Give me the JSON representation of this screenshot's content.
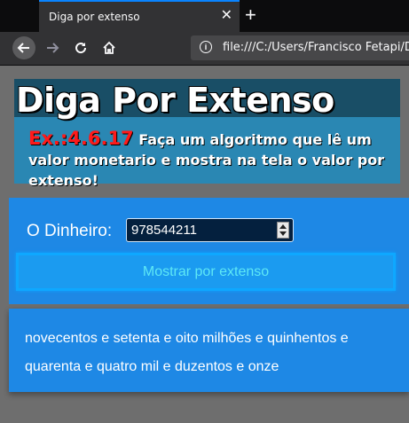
{
  "browser": {
    "tab_title": "Diga por extenso",
    "close_glyph": "✕",
    "new_tab_glyph": "+",
    "url": "file:///C:/Users/Francisco Fetapi/De"
  },
  "header": {
    "title": "Diga Por Extenso",
    "exercise_id": "Ex.:4.6.17",
    "description": " Faça um algoritmo que lê um valor monetario e mostra na tela o valor por extenso!"
  },
  "form": {
    "label": "O Dinheiro:",
    "input_value": "978544211",
    "button_label": "Mostrar por extenso"
  },
  "result": {
    "text": "novecentos e setenta e oito milhões e quinhentos e quarenta e quatro mil e duzentos e onze"
  },
  "colors": {
    "header_band": "#194e66",
    "header_bg": "#2a87b3",
    "panel": "#1e88e5",
    "exercise_red": "#ff1a1a"
  }
}
